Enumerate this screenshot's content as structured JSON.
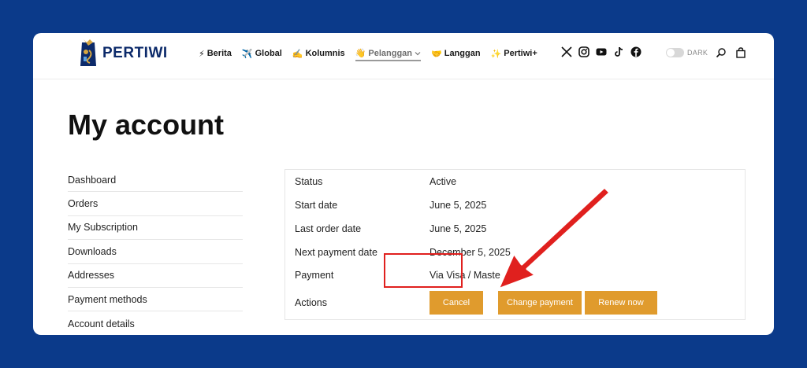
{
  "brand": {
    "name": "PERTIWI"
  },
  "nav": [
    {
      "icon": "⚡",
      "label": "Berita"
    },
    {
      "icon": "✈️",
      "label": "Global"
    },
    {
      "icon": "✍️",
      "label": "Kolumnis"
    },
    {
      "icon": "👋",
      "label": "Pelanggan",
      "active": true
    },
    {
      "icon": "🤝",
      "label": "Langgan"
    },
    {
      "icon": "✨",
      "label": "Pertiwi+"
    }
  ],
  "social_icons": [
    "x-icon",
    "instagram-icon",
    "youtube-icon",
    "tiktok-icon",
    "facebook-icon"
  ],
  "theme_toggle": {
    "label": "DARK"
  },
  "page": {
    "title": "My account"
  },
  "sidebar": {
    "items": [
      {
        "label": "Dashboard"
      },
      {
        "label": "Orders"
      },
      {
        "label": "My Subscription"
      },
      {
        "label": "Downloads"
      },
      {
        "label": "Addresses"
      },
      {
        "label": "Payment methods"
      },
      {
        "label": "Account details"
      }
    ]
  },
  "subscription": {
    "rows": [
      {
        "label": "Status",
        "value": "Active"
      },
      {
        "label": "Start date",
        "value": "June 5, 2025"
      },
      {
        "label": "Last order date",
        "value": "June 5, 2025"
      },
      {
        "label": "Next payment date",
        "value": "December 5, 2025"
      },
      {
        "label": "Payment",
        "value": "Via Visa / Maste"
      },
      {
        "label": "Actions",
        "value": ""
      }
    ],
    "actions": {
      "cancel": "Cancel",
      "change_payment": "Change payment",
      "renew": "Renew now"
    }
  },
  "colors": {
    "background": "#0b3a8a",
    "button": "#e09b2d",
    "annotation": "#e0201e"
  }
}
